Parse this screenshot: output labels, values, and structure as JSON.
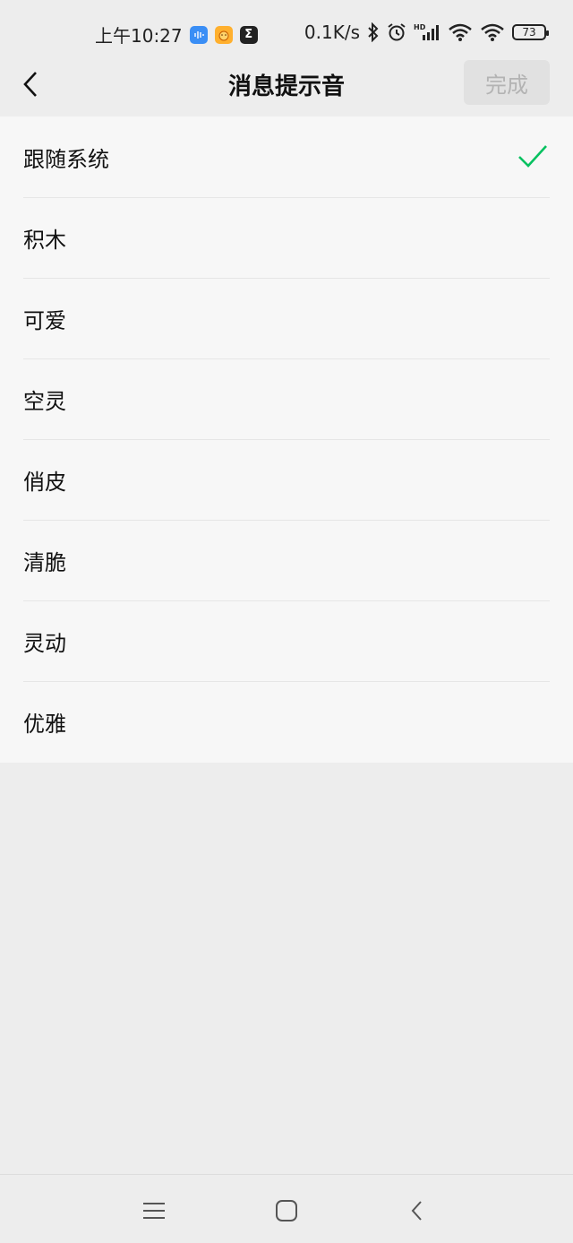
{
  "status_bar": {
    "time": "上午10:27",
    "net_speed": "0.1K/s",
    "battery": "73",
    "hd_label": "HD",
    "apps": [
      {
        "icon": "voice-app-icon"
      },
      {
        "icon": "cartoon-app-icon"
      },
      {
        "icon": "sigma-app-icon",
        "glyph": "Σ"
      }
    ]
  },
  "nav": {
    "back_icon": "chevron-left-icon",
    "title": "消息提示音",
    "done_label": "完成"
  },
  "sounds": [
    {
      "label": "跟随系统",
      "selected": true
    },
    {
      "label": "积木",
      "selected": false
    },
    {
      "label": "可爱",
      "selected": false
    },
    {
      "label": "空灵",
      "selected": false
    },
    {
      "label": "俏皮",
      "selected": false
    },
    {
      "label": "清脆",
      "selected": false
    },
    {
      "label": "灵动",
      "selected": false
    },
    {
      "label": "优雅",
      "selected": false
    }
  ],
  "colors": {
    "check": "#07c160",
    "done_bg": "#e1e1e1",
    "done_text": "#b3b3b3"
  },
  "system_nav": [
    "menu-icon",
    "home-icon",
    "back-icon"
  ]
}
